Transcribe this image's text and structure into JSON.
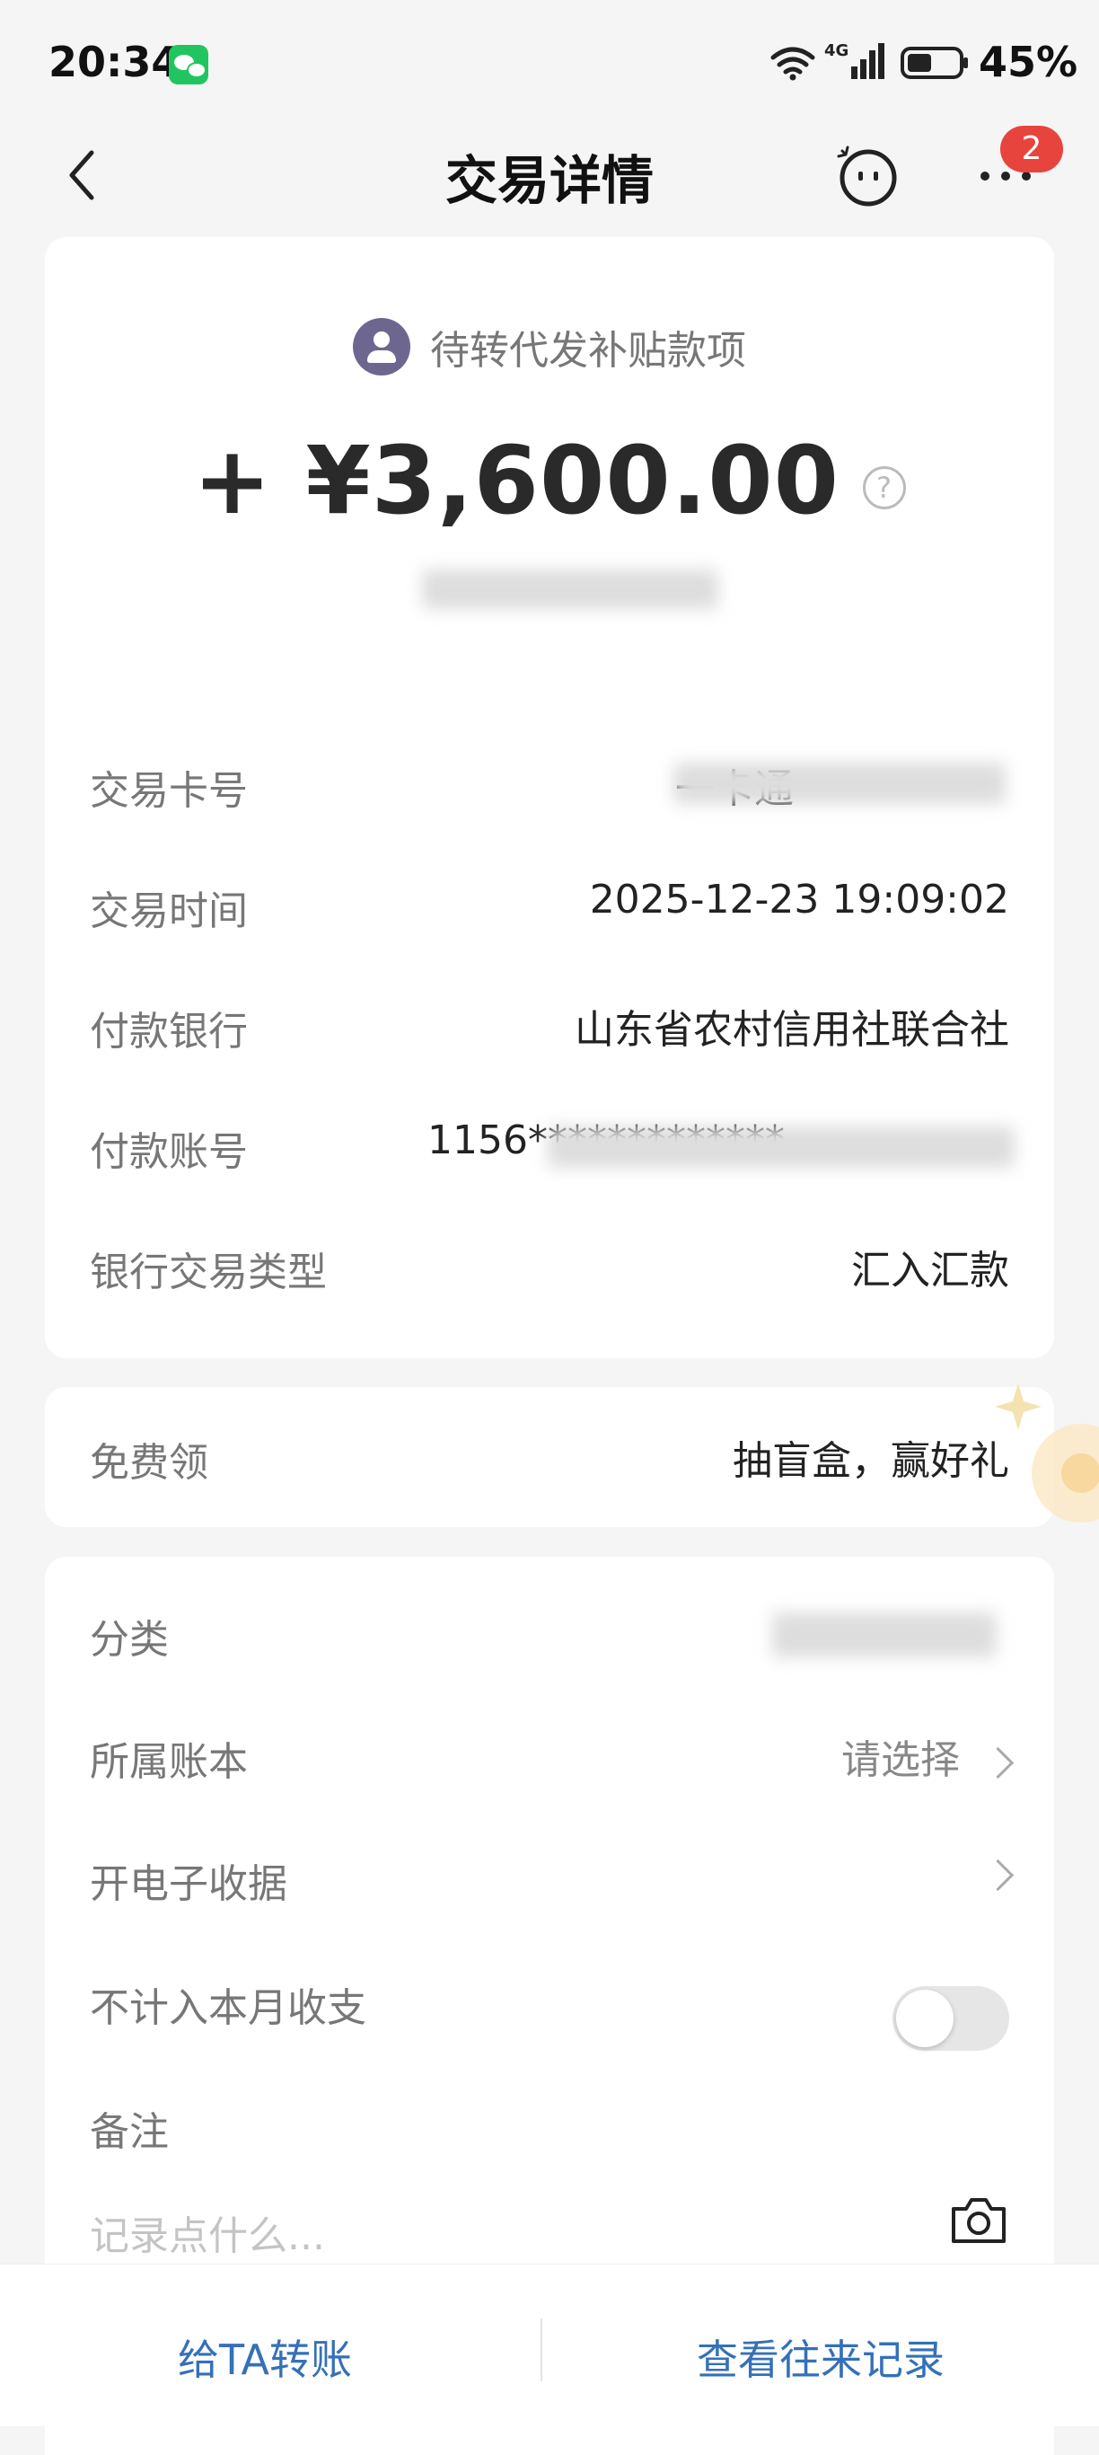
{
  "status_bar": {
    "time": "20:34",
    "battery": "45%",
    "network": "4G"
  },
  "nav": {
    "title": "交易详情",
    "badge_count": "2"
  },
  "summary": {
    "payee": "待转代发补贴款项",
    "amount": "+ ¥3,600.00"
  },
  "details": [
    {
      "label": "交易卡号",
      "value": "一卡通"
    },
    {
      "label": "交易时间",
      "value": "2025-12-23 19:09:02"
    },
    {
      "label": "付款银行",
      "value": "山东省农村信用社联合社"
    },
    {
      "label": "付款账号",
      "value": "1156*************"
    },
    {
      "label": "银行交易类型",
      "value": "汇入汇款"
    }
  ],
  "promo": {
    "label": "免费领",
    "value": "抽盲盒，赢好礼"
  },
  "settings": {
    "category_label": "分类",
    "ledger_label": "所属账本",
    "ledger_value": "请选择",
    "receipt_label": "开电子收据",
    "exclude_label": "不计入本月收支",
    "exclude_enabled": false,
    "remark_label": "备注",
    "remark_placeholder": "记录点什么..."
  },
  "bottom": {
    "transfer_label": "给TA转账",
    "history_label": "查看往来记录"
  }
}
